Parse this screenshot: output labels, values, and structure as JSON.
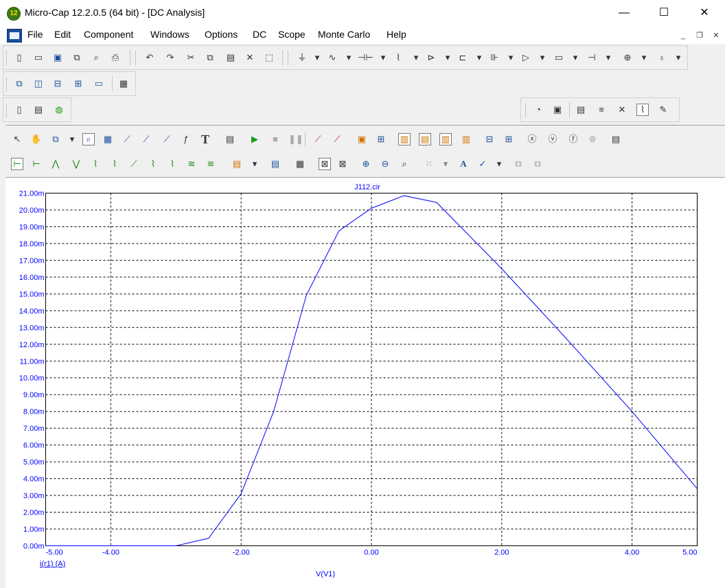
{
  "window": {
    "title": "Micro-Cap 12.2.0.5 (64 bit) - [DC Analysis]",
    "app_badge": "12",
    "minimize": "—",
    "maximize": "☐",
    "close": "✕"
  },
  "menu": {
    "items": [
      "File",
      "Edit",
      "Component",
      "Windows",
      "Options",
      "DC",
      "Scope",
      "Monte Carlo",
      "Help"
    ],
    "mdi_minimize": "_",
    "mdi_restore": "❐",
    "mdi_close": "✕"
  },
  "toolbars": {
    "file_icons": [
      "new-icon",
      "open-icon",
      "save-icon",
      "save-as-icon",
      "print-preview-icon",
      "print-icon"
    ],
    "edit_icons": [
      "undo-icon",
      "redo-icon",
      "cut-icon",
      "copy-icon",
      "paste-icon",
      "delete-icon",
      "select-all-icon"
    ],
    "component_icons": [
      "ground-icon",
      "wire-icon",
      "capacitor-icon",
      "resistor-icon",
      "diode-icon",
      "transistor-icon",
      "mosfet-icon",
      "opamp-icon",
      "macro-icon",
      "battery-icon",
      "source-icon",
      "probe-icon"
    ],
    "text_tool_label": "T",
    "font_tool_label": "A"
  },
  "chart_data": {
    "type": "line",
    "title": "J112.cir",
    "xlabel": "V(V1)",
    "ylabel": "i(r1) (A)",
    "xlim": [
      -5.0,
      5.0
    ],
    "ylim": [
      0.0,
      21.0
    ],
    "y_unit_suffix": "m",
    "x_ticks": [
      "-5.00",
      "-4.00",
      "-2.00",
      "0.00",
      "2.00",
      "4.00",
      "5.00"
    ],
    "y_ticks": [
      "0.00m",
      "1.00m",
      "2.00m",
      "3.00m",
      "4.00m",
      "5.00m",
      "6.00m",
      "7.00m",
      "8.00m",
      "9.00m",
      "10.00m",
      "11.00m",
      "12.00m",
      "13.00m",
      "14.00m",
      "15.00m",
      "16.00m",
      "17.00m",
      "18.00m",
      "19.00m",
      "20.00m",
      "21.00m"
    ],
    "grid": true,
    "series": [
      {
        "color": "#0000ff",
        "x": [
          -5.0,
          -4.0,
          -3.0,
          -2.5,
          -2.0,
          -1.5,
          -1.0,
          -0.5,
          0.0,
          0.5,
          1.0,
          2.0,
          3.0,
          4.0,
          5.0
        ],
        "y": [
          0.0,
          0.0,
          0.0,
          0.45,
          3.1,
          8.0,
          14.9,
          18.75,
          20.1,
          20.85,
          20.45,
          16.5,
          12.3,
          8.0,
          3.4
        ]
      }
    ]
  },
  "colors": {
    "axis_text": "#0000ff",
    "curve": "#0000ff",
    "grid": "#000000"
  }
}
